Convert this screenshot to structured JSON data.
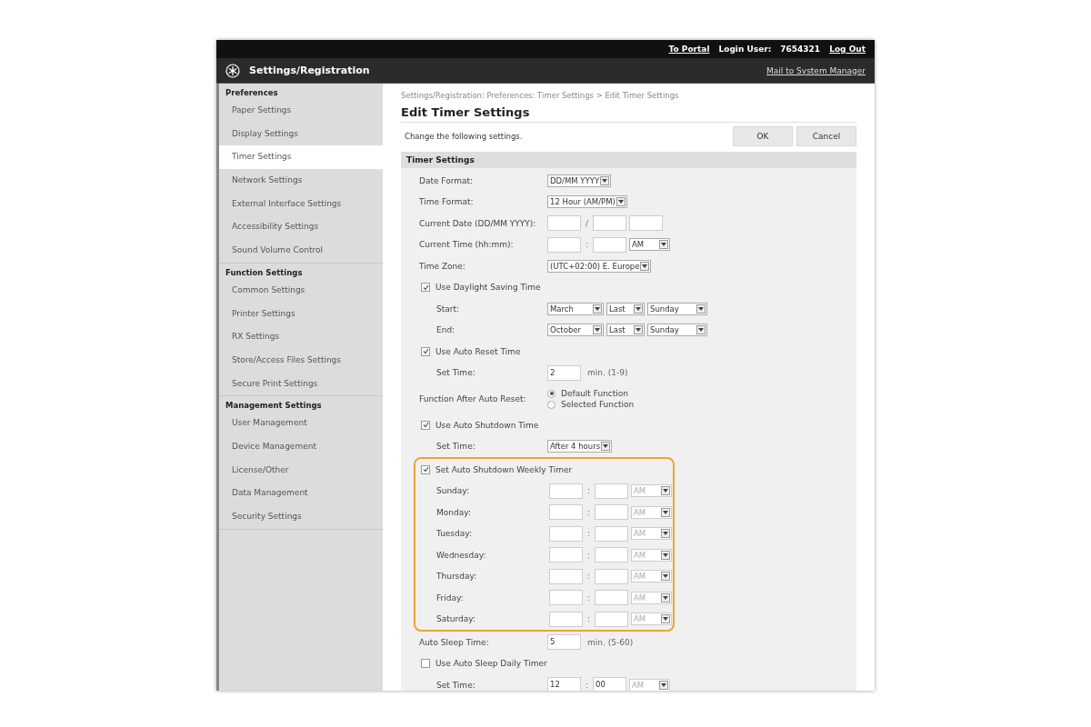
{
  "top_bar": {
    "links": [
      {
        "kind": "link",
        "text": "To Portal"
      },
      {
        "kind": "label",
        "text": "Login User:"
      },
      {
        "kind": "value",
        "text": "7654321"
      },
      {
        "kind": "link",
        "text": "Log Out"
      }
    ]
  },
  "header": {
    "title": "Settings/Registration",
    "link": "Mail to System Manager"
  },
  "sidebar": {
    "groups": [
      {
        "title": "Preferences",
        "items": [
          {
            "label": "Paper Settings",
            "selected": false
          },
          {
            "label": "Display Settings",
            "selected": false
          },
          {
            "label": "Timer Settings",
            "selected": true
          },
          {
            "label": "Network Settings",
            "selected": false
          },
          {
            "label": "External Interface Settings",
            "selected": false
          },
          {
            "label": "Accessibility Settings",
            "selected": false
          },
          {
            "label": "Sound Volume Control",
            "selected": false
          }
        ]
      },
      {
        "title": "Function Settings",
        "items": [
          {
            "label": "Common Settings",
            "selected": false
          },
          {
            "label": "Printer Settings",
            "selected": false
          },
          {
            "label": "RX Settings",
            "selected": false
          },
          {
            "label": "Store/Access Files Settings",
            "selected": false
          },
          {
            "label": "Secure Print Settings",
            "selected": false
          }
        ]
      },
      {
        "title": "Management Settings",
        "items": [
          {
            "label": "User Management",
            "selected": false
          },
          {
            "label": "Device Management",
            "selected": false
          },
          {
            "label": "License/Other",
            "selected": false
          },
          {
            "label": "Data Management",
            "selected": false
          },
          {
            "label": "Security Settings",
            "selected": false
          }
        ]
      }
    ]
  },
  "breadcrumb": "Settings/Registration: Preferences: Timer Settings > Edit Timer Settings",
  "page_title": "Edit Timer Settings",
  "description": "Change the following settings.",
  "buttons": [
    "OK",
    "Cancel"
  ],
  "section": {
    "title": "Timer Settings",
    "rows": [
      {
        "kind": "select",
        "label": "Date Format:",
        "value": "DD/MM YYYY"
      },
      {
        "kind": "select",
        "label": "Time Format:",
        "value": "12 Hour (AM/PM)"
      },
      {
        "kind": "date",
        "label": "Current Date (DD/MM YYYY):",
        "separator": "/"
      },
      {
        "kind": "time",
        "label": "Current Time (hh:mm):",
        "separator": ":",
        "ampm": "AM",
        "disabled": false
      },
      {
        "kind": "select",
        "label": "Time Zone:",
        "value": "(UTC+02:00) E. Europe"
      },
      {
        "kind": "checkbox",
        "label": "Use Daylight Saving Time",
        "checked": true,
        "highlighted": false,
        "children": [
          {
            "kind": "triple",
            "label": "Start:",
            "values": [
              "March",
              "Last",
              "Sunday"
            ]
          },
          {
            "kind": "triple",
            "label": "End:",
            "values": [
              "October",
              "Last",
              "Sunday"
            ]
          }
        ]
      },
      {
        "kind": "checkbox",
        "label": "Use Auto Reset Time",
        "checked": true,
        "highlighted": false,
        "children": [
          {
            "kind": "number",
            "label": "Set Time:",
            "value": "2",
            "unit": "min. (1-9)"
          }
        ]
      },
      {
        "kind": "radio",
        "label": "Function After Auto Reset:",
        "options": [
          {
            "label": "Default Function",
            "selected": true
          },
          {
            "label": "Selected Function",
            "selected": false
          }
        ]
      },
      {
        "kind": "checkbox",
        "label": "Use Auto Shutdown Time",
        "checked": true,
        "highlighted": false,
        "children": [
          {
            "kind": "select",
            "label": "Set Time:",
            "value": "After 4 hours"
          }
        ]
      },
      {
        "kind": "checkbox",
        "label": "Set Auto Shutdown Weekly Timer",
        "checked": true,
        "highlighted": true,
        "children": [
          {
            "kind": "time",
            "label": "Sunday:",
            "separator": ":",
            "ampm": "AM",
            "disabled": true
          },
          {
            "kind": "time",
            "label": "Monday:",
            "separator": ":",
            "ampm": "AM",
            "disabled": true
          },
          {
            "kind": "time",
            "label": "Tuesday:",
            "separator": ":",
            "ampm": "AM",
            "disabled": true
          },
          {
            "kind": "time",
            "label": "Wednesday:",
            "separator": ":",
            "ampm": "AM",
            "disabled": true
          },
          {
            "kind": "time",
            "label": "Thursday:",
            "separator": ":",
            "ampm": "AM",
            "disabled": true
          },
          {
            "kind": "time",
            "label": "Friday:",
            "separator": ":",
            "ampm": "AM",
            "disabled": true
          },
          {
            "kind": "time",
            "label": "Saturday:",
            "separator": ":",
            "ampm": "AM",
            "disabled": true
          }
        ]
      },
      {
        "kind": "number",
        "label": "Auto Sleep Time:",
        "value": "5",
        "unit": "min. (5-60)"
      },
      {
        "kind": "checkbox",
        "label": "Use Auto Sleep Daily Timer",
        "checked": false,
        "highlighted": false,
        "children": [
          {
            "kind": "time",
            "label": "Set Time:",
            "hour": "12",
            "minute": "00",
            "separator": ":",
            "ampm": "AM",
            "disabled": true
          }
        ]
      }
    ]
  }
}
